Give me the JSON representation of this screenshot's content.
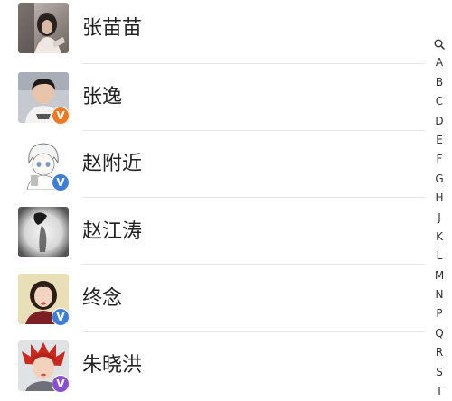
{
  "colors": {
    "badge_orange": "#f07820",
    "badge_blue": "#3f7ed8",
    "badge_purple": "#8a4fd0",
    "divider": "#e6e6e6"
  },
  "contacts": [
    {
      "name": "张苗苗",
      "badge": "",
      "badge_color": ""
    },
    {
      "name": "张逸",
      "badge": "V",
      "badge_color": "orange"
    },
    {
      "name": "赵附近",
      "badge": "V",
      "badge_color": "blue"
    },
    {
      "name": "赵江涛",
      "badge": "",
      "badge_color": ""
    },
    {
      "name": "终念",
      "badge": "V",
      "badge_color": "blue"
    },
    {
      "name": "朱晓洪",
      "badge": "V",
      "badge_color": "purple"
    }
  ],
  "index_bar": {
    "search_icon": "search-icon",
    "letters": [
      "A",
      "B",
      "C",
      "D",
      "E",
      "F",
      "G",
      "H",
      "J",
      "K",
      "L",
      "M",
      "N",
      "P",
      "Q",
      "R",
      "S",
      "T"
    ]
  }
}
